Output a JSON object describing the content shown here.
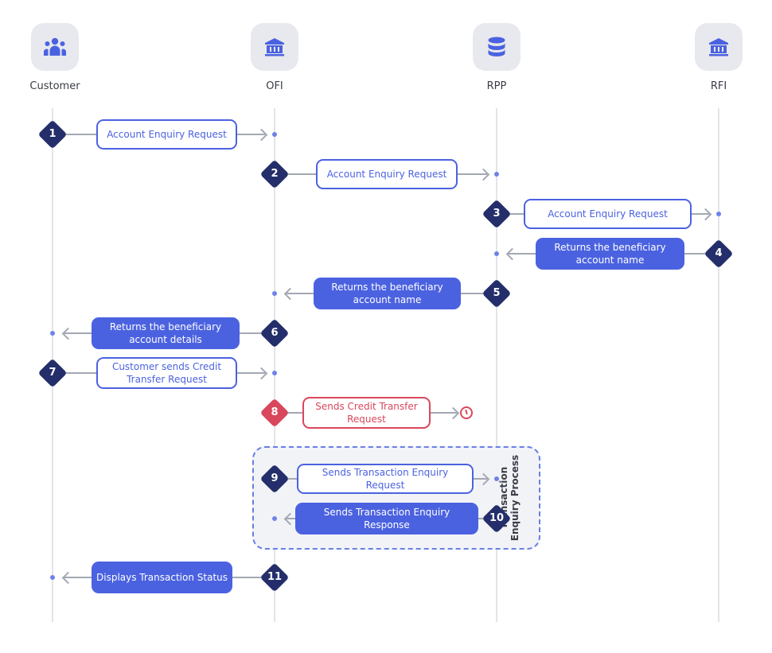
{
  "colors": {
    "accent": "#4b62e0",
    "badge": "#242e6b",
    "error": "#d9475c",
    "lifeline": "#e3e4ea",
    "connector": "#a3a8b3",
    "group_bg": "#f2f3f6"
  },
  "actors": [
    {
      "name": "Customer",
      "icon": "users-icon"
    },
    {
      "name": "OFI",
      "icon": "bank-icon"
    },
    {
      "name": "RPP",
      "icon": "database-icon"
    },
    {
      "name": "RFI",
      "icon": "bank-icon"
    }
  ],
  "group": {
    "label": "Transaction Enquiry Process",
    "steps": [
      9,
      10
    ]
  },
  "steps": [
    {
      "num": "1",
      "from": "Customer",
      "to": "OFI",
      "label": "Account Enquiry Request",
      "style": "outline"
    },
    {
      "num": "2",
      "from": "OFI",
      "to": "RPP",
      "label": "Account Enquiry Request",
      "style": "outline"
    },
    {
      "num": "3",
      "from": "RPP",
      "to": "RFI",
      "label": "Account Enquiry Request",
      "style": "outline"
    },
    {
      "num": "4",
      "from": "RFI",
      "to": "RPP",
      "label": "Returns the beneficiary account name",
      "style": "filled"
    },
    {
      "num": "5",
      "from": "RPP",
      "to": "OFI",
      "label": "Returns the beneficiary account name",
      "style": "filled"
    },
    {
      "num": "6",
      "from": "OFI",
      "to": "Customer",
      "label": "Returns the beneficiary account details",
      "style": "filled"
    },
    {
      "num": "7",
      "from": "Customer",
      "to": "OFI",
      "label": "Customer sends Credit Transfer Request",
      "style": "outline"
    },
    {
      "num": "8",
      "from": "OFI",
      "to": "timeout",
      "label": "Sends Credit Transfer Request",
      "style": "error",
      "end_icon": "clock-icon"
    },
    {
      "num": "9",
      "from": "OFI",
      "to": "RPP",
      "label": "Sends Transaction Enquiry Request",
      "style": "outline"
    },
    {
      "num": "10",
      "from": "RPP",
      "to": "OFI",
      "label": "Sends Transaction Enquiry Response",
      "style": "filled"
    },
    {
      "num": "11",
      "from": "OFI",
      "to": "Customer",
      "label": "Displays Transaction Status",
      "style": "filled"
    }
  ]
}
